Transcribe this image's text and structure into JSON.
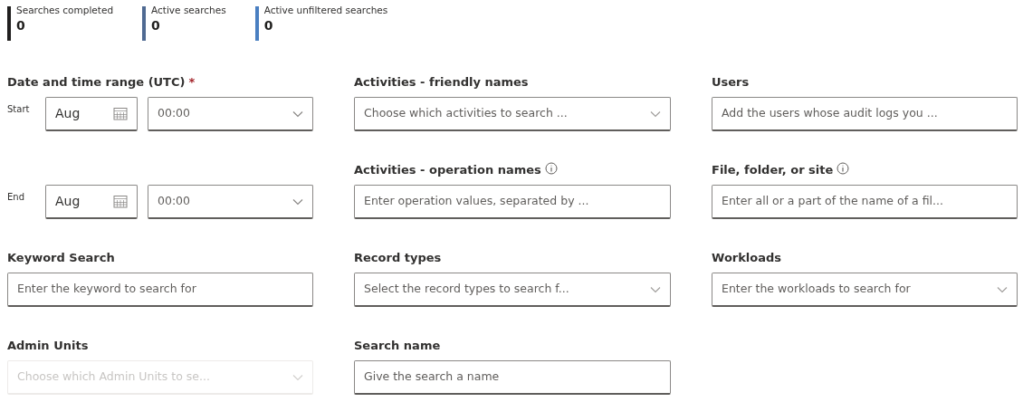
{
  "stats": [
    {
      "label": "Searches completed",
      "value": "0",
      "color": "#201f1e"
    },
    {
      "label": "Active searches",
      "value": "0",
      "color": "#4f6a92"
    },
    {
      "label": "Active unfiltered searches",
      "value": "0",
      "color": "#4a7fc1"
    }
  ],
  "columns": [
    {
      "items": [
        {
          "kind": "daterange",
          "label": "Date and time range (UTC)",
          "required_mark": "*",
          "rows": [
            {
              "label": "Start",
              "date": "Aug",
              "time": "00:00"
            },
            {
              "label": "End",
              "date": "Aug",
              "time": "00:00"
            }
          ]
        },
        {
          "kind": "text",
          "label": "Keyword Search",
          "placeholder": "Enter the keyword to search for",
          "disabled": false
        },
        {
          "kind": "dropdown",
          "label": "Admin Units",
          "placeholder": "Choose which Admin Units to se...",
          "disabled": true
        }
      ]
    },
    {
      "items": [
        {
          "kind": "dropdown",
          "label": "Activities - friendly names",
          "placeholder": "Choose which activities to search ...",
          "disabled": false
        },
        {
          "kind": "text",
          "label": "Activities - operation names",
          "info": true,
          "placeholder": "Enter operation values, separated by ...",
          "disabled": false
        },
        {
          "kind": "dropdown",
          "label": "Record types",
          "placeholder": "Select the record types to search f...",
          "disabled": false
        },
        {
          "kind": "text",
          "label": "Search name",
          "placeholder": "Give the search a name",
          "disabled": false
        }
      ]
    },
    {
      "items": [
        {
          "kind": "text",
          "label": "Users",
          "placeholder": "Add the users whose audit logs you ...",
          "disabled": false
        },
        {
          "kind": "text",
          "label": "File, folder, or site",
          "info": true,
          "placeholder": "Enter all or a part of the name of a fil...",
          "disabled": false
        },
        {
          "kind": "dropdown",
          "label": "Workloads",
          "placeholder": "Enter the workloads to search for",
          "disabled": false
        }
      ]
    }
  ]
}
